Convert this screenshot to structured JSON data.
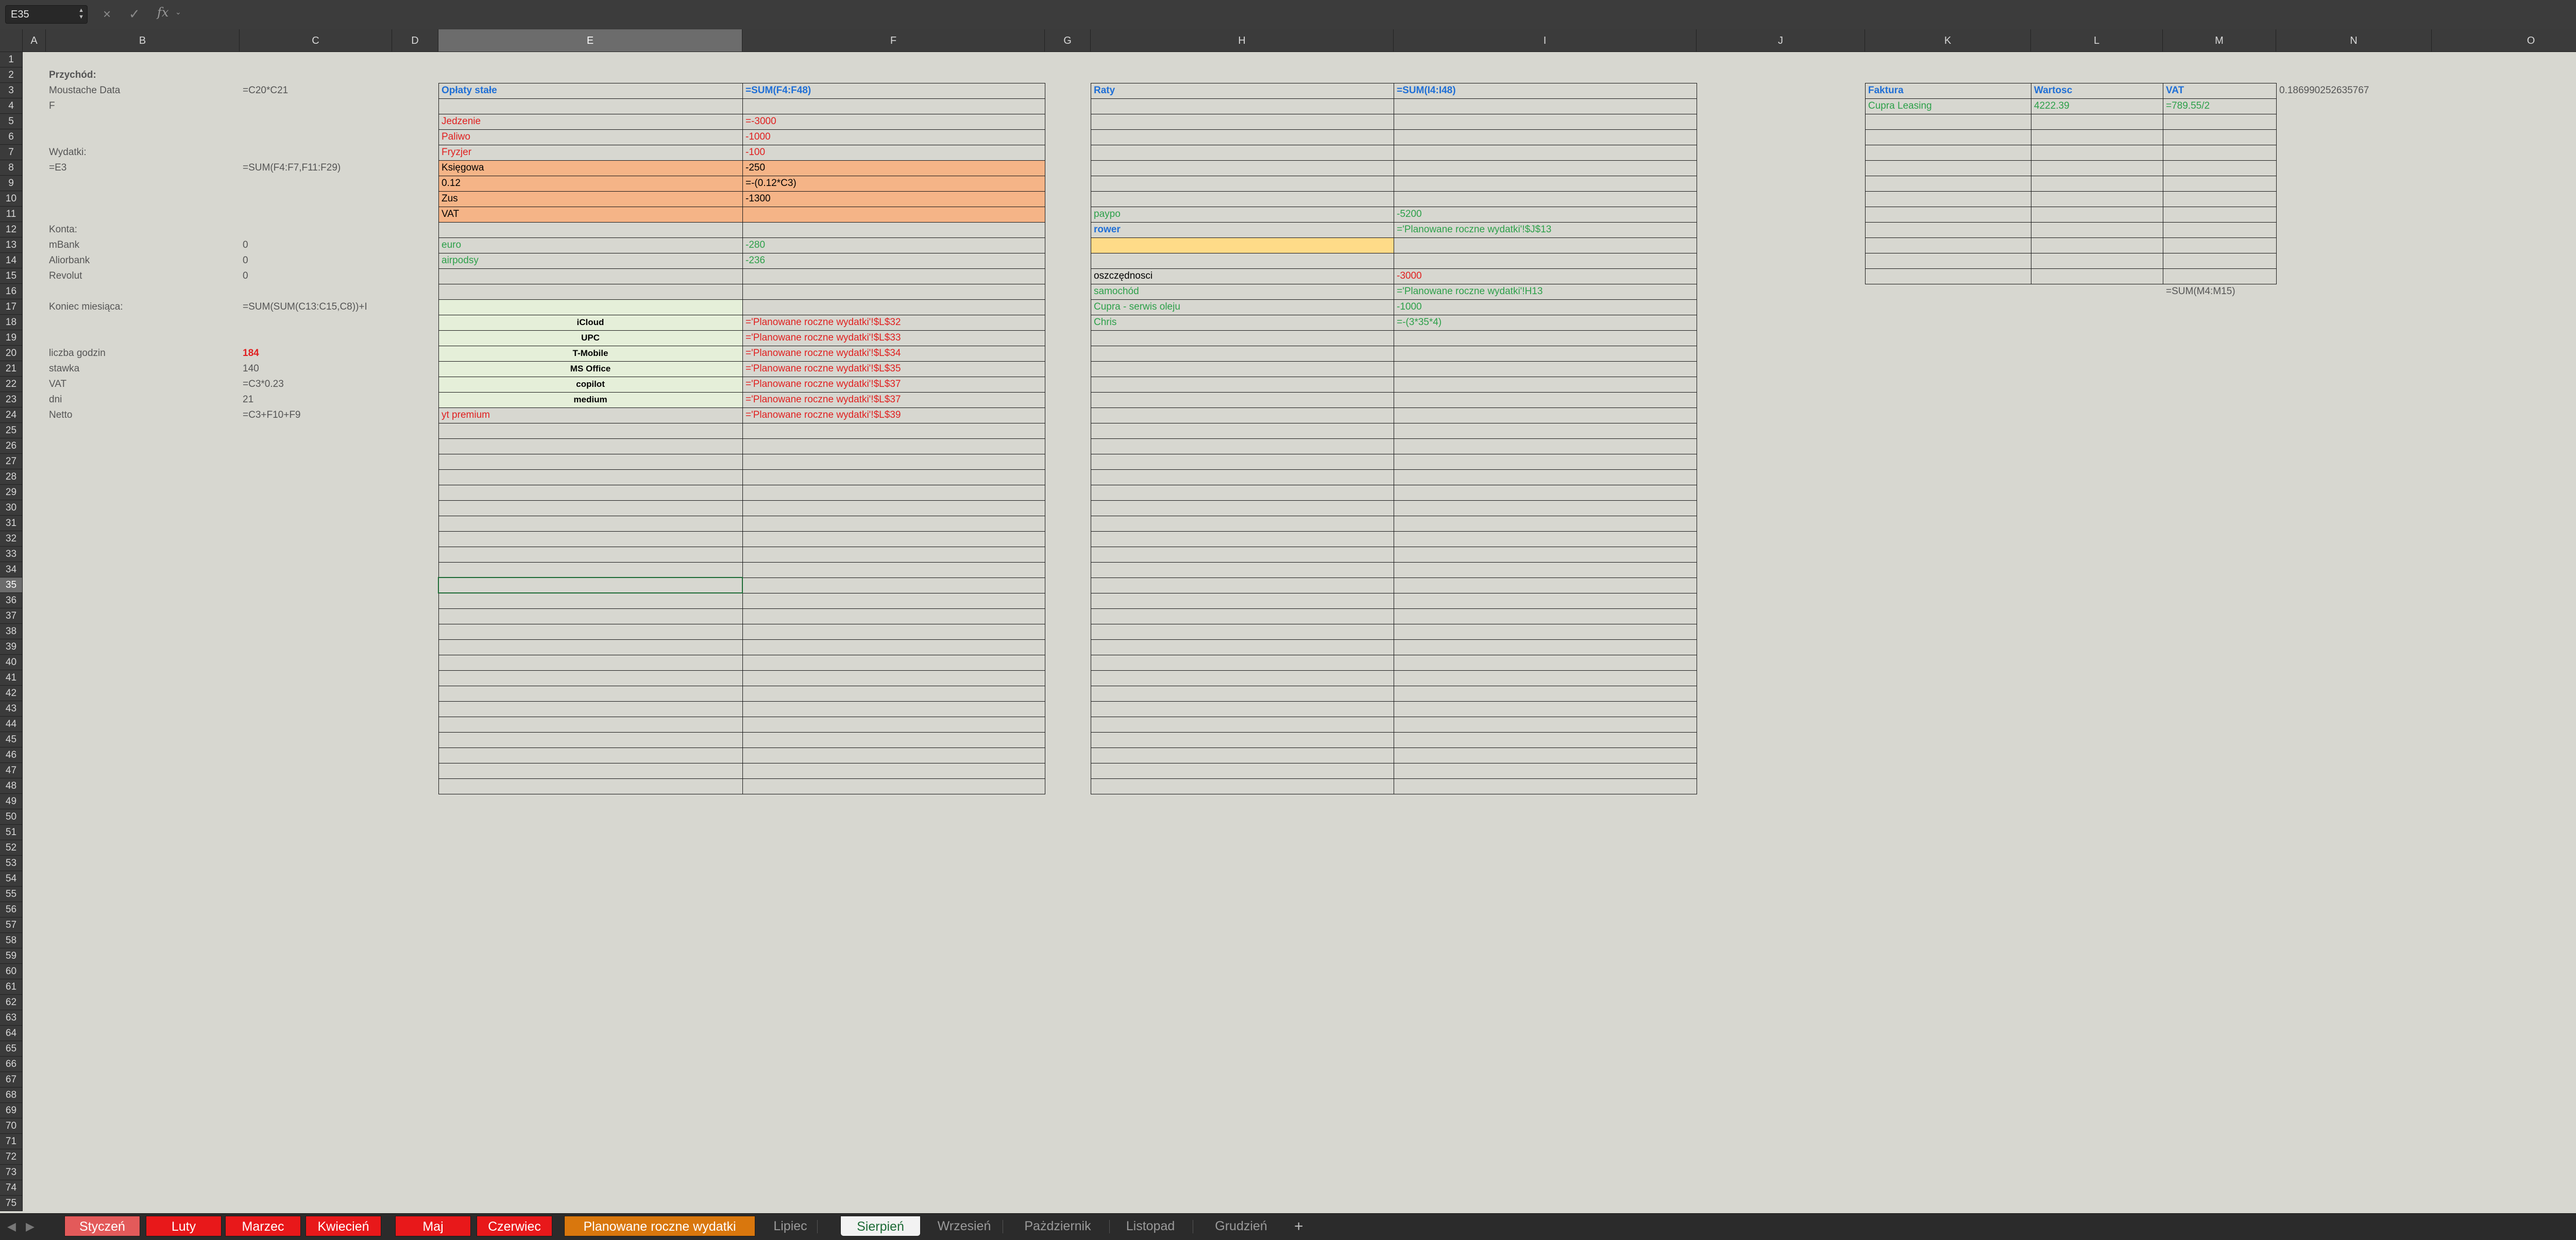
{
  "namebox": {
    "ref": "E35"
  },
  "formula_bar": {
    "fx": "fx",
    "value": ""
  },
  "columns": [
    "A",
    "B",
    "C",
    "D",
    "E",
    "F",
    "G",
    "H",
    "I",
    "J",
    "K",
    "L",
    "M",
    "N",
    "O"
  ],
  "selected_column": "E",
  "selected_row": 35,
  "rows_count": 75,
  "cells": {
    "B2": "Przychód:",
    "B3": "Moustache Data",
    "C3": "=C20*C21",
    "B4": "F",
    "B7": "Wydatki:",
    "B8": "=E3",
    "C8": "=SUM(F4:F7,F11:F29)",
    "B12": "Konta:",
    "B13": "mBank",
    "C13": "0",
    "B14": "Aliorbank",
    "C14": "0",
    "B15": "Revolut",
    "C15": "0",
    "B17": "Koniec miesiąca:",
    "C17": "=SUM(SUM(C13:C15,C8))+I",
    "B20": "liczba godzin",
    "C20": "184",
    "B21": "stawka",
    "C21": "140",
    "B22": "VAT",
    "C22": "=C3*0.23",
    "B23": "dni",
    "C23": "21",
    "B24": "Netto",
    "C24": "=C3+F10+F9",
    "E3": "Opłaty stałe",
    "F3": "=SUM(F4:F48)",
    "E5": "Jedzenie",
    "F5": "=-3000",
    "E6": "Paliwo",
    "F6": "-1000",
    "E7": "Fryzjer",
    "F7": "-100",
    "E8": "Księgowa",
    "F8": "-250",
    "E9": "0.12",
    "F9": "=-(0.12*C3)",
    "E10": "Zus",
    "F10": "-1300",
    "E11": "VAT",
    "E13": "euro",
    "F13": "-280",
    "E14": "airpodsy",
    "F14": "-236",
    "E18": "iCloud",
    "F18": "='Planowane roczne wydatki'!$L$32",
    "E19": "UPC",
    "F19": "='Planowane roczne wydatki'!$L$33",
    "E20": "T-Mobile",
    "F20": "='Planowane roczne wydatki'!$L$34",
    "E21": "MS Office",
    "F21": "='Planowane roczne wydatki'!$L$35",
    "E22": "copilot",
    "F22": "='Planowane roczne wydatki'!$L$37",
    "E23": "medium",
    "F23": "='Planowane roczne wydatki'!$L$37",
    "E24": "yt premium",
    "F24": "='Planowane roczne wydatki'!$L$39",
    "H3": "Raty",
    "I3": "=SUM(I4:I48)",
    "H11": "paypo",
    "I11": "-5200",
    "H12": "rower",
    "I12": "='Planowane roczne wydatki'!$J$13",
    "H15": "oszczędnosci",
    "I15": "-3000",
    "H16": "samochód",
    "I16": "='Planowane roczne wydatki'!H13",
    "H17": "Cupra - serwis oleju",
    "I17": "-1000",
    "H18": "Chris",
    "I18": "=-(3*35*4)",
    "K3": "Faktura",
    "L3": "Wartosc",
    "M3": "VAT",
    "N3": "0.186990252635767",
    "K4": "Cupra Leasing",
    "L4": "4222.39",
    "M4": "=789.55/2",
    "M16": "=SUM(M4:M15)"
  },
  "tabs": [
    {
      "label": "Styczeń",
      "style": "red-light"
    },
    {
      "label": "Luty",
      "style": "red"
    },
    {
      "label": "Marzec",
      "style": "red"
    },
    {
      "label": "Kwiecień",
      "style": "red"
    },
    {
      "label": "Maj",
      "style": "red"
    },
    {
      "label": "Czerwiec",
      "style": "red"
    },
    {
      "label": "Planowane roczne wydatki",
      "style": "orange"
    },
    {
      "label": "Lipiec",
      "style": "plain"
    },
    {
      "label": "Sierpień",
      "style": "active"
    },
    {
      "label": "Wrzesień",
      "style": "plain"
    },
    {
      "label": "Pażdziernik",
      "style": "plain"
    },
    {
      "label": "Listopad",
      "style": "plain"
    },
    {
      "label": "Grudzień",
      "style": "plain"
    }
  ],
  "add_tab_label": "+",
  "colors": {
    "accent_green": "#1d6b36",
    "tab_red": "#e8181a",
    "tab_red_light": "#e35a5a",
    "tab_orange": "#d9770d",
    "fill_orange": "#f5b487",
    "fill_lightgreen": "#e5efd9",
    "fill_yellow": "#fedb88"
  }
}
